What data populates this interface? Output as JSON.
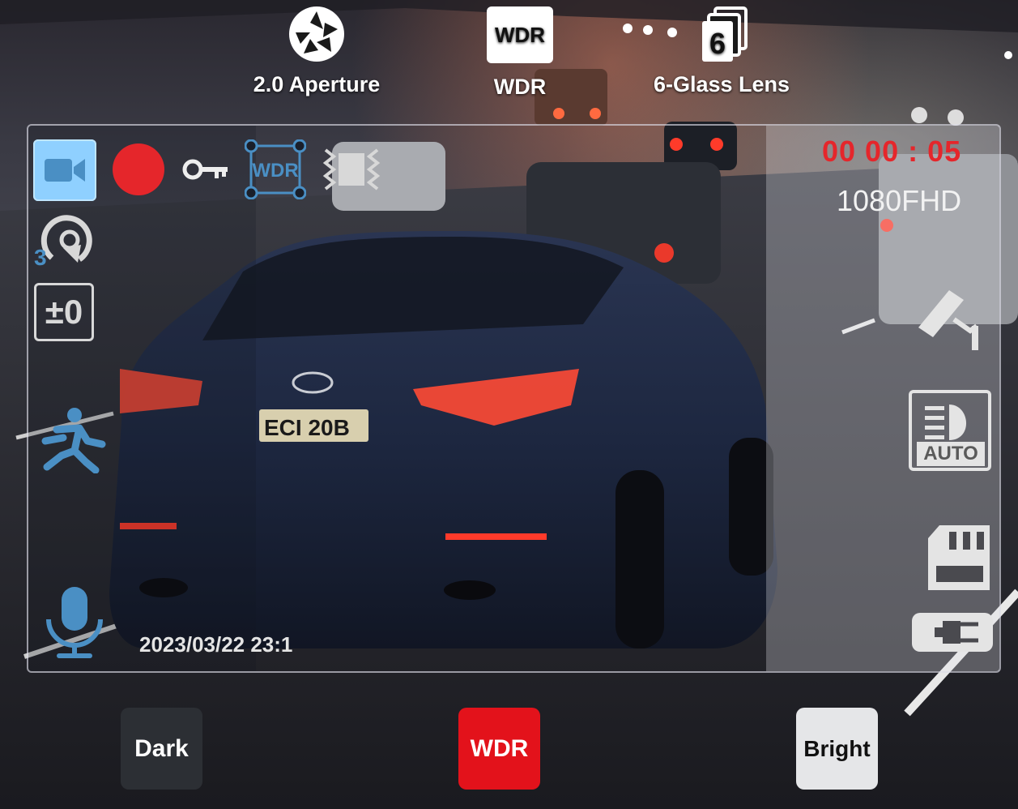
{
  "features": [
    {
      "label": "2.0 Aperture",
      "icon": "aperture-icon"
    },
    {
      "label": "WDR",
      "badge": "WDR",
      "icon": "wdr-badge-icon"
    },
    {
      "label": "6-Glass Lens",
      "badge": "6",
      "icon": "glass-lens-icon"
    }
  ],
  "overlay": {
    "record_timer": "00  00 : 05",
    "resolution": "1080FHD",
    "timestamp": "2023/03/22 23:1",
    "loop_count": "3",
    "exposure_label": "±0",
    "wdr_icon_label": "WDR",
    "headlight_label": "AUTO"
  },
  "modes": {
    "dark": "Dark",
    "wdr": "WDR",
    "bright": "Bright"
  },
  "plate": "ECI 20B",
  "colors": {
    "record_red": "#e5262b",
    "accent_blue": "#4a8fc4",
    "wdr_button_red": "#e3121b"
  }
}
